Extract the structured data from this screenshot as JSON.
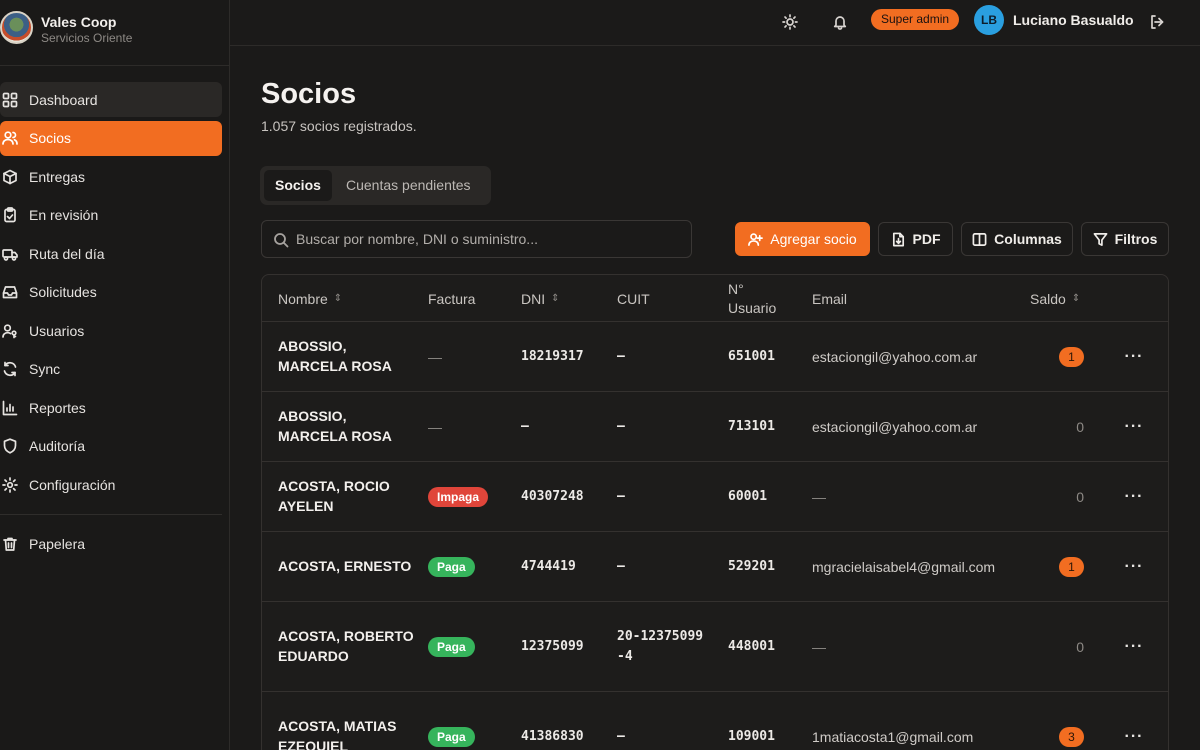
{
  "brand": {
    "name": "Vales Coop",
    "subtitle": "Servicios Oriente"
  },
  "sidebar": {
    "items": [
      {
        "label": "Dashboard",
        "icon": "dashboard-icon"
      },
      {
        "label": "Socios",
        "icon": "users-icon"
      },
      {
        "label": "Entregas",
        "icon": "package-icon"
      },
      {
        "label": "En revisión",
        "icon": "clipboard-icon"
      },
      {
        "label": "Ruta del día",
        "icon": "truck-icon"
      },
      {
        "label": "Solicitudes",
        "icon": "inbox-icon"
      },
      {
        "label": "Usuarios",
        "icon": "user-key-icon"
      },
      {
        "label": "Sync",
        "icon": "sync-icon"
      },
      {
        "label": "Reportes",
        "icon": "bar-chart-icon"
      },
      {
        "label": "Auditoría",
        "icon": "shield-icon"
      },
      {
        "label": "Configuración",
        "icon": "gear-icon"
      }
    ],
    "trash": {
      "label": "Papelera",
      "icon": "trash-icon"
    }
  },
  "topbar": {
    "role": "Super admin",
    "avatar_initials": "LB",
    "user_name": "Luciano Basualdo"
  },
  "page": {
    "title": "Socios",
    "subtitle": "1.057 socios registrados."
  },
  "tabs": [
    "Socios",
    "Cuentas pendientes"
  ],
  "search": {
    "placeholder": "Buscar por nombre, DNI o suministro...",
    "value": ""
  },
  "toolbar": {
    "add_label": "Agregar socio",
    "pdf_label": "PDF",
    "columns_label": "Columnas",
    "filters_label": "Filtros"
  },
  "table": {
    "headers": {
      "nombre": "Nombre",
      "factura": "Factura",
      "dni": "DNI",
      "cuit": "CUIT",
      "usuario": "N° Usuario",
      "email": "Email",
      "saldo": "Saldo"
    },
    "rows": [
      {
        "nombre": "ABOSSIO, MARCELA ROSA",
        "factura": "—",
        "dni": "18219317",
        "cuit": "–",
        "usuario": "651001",
        "email": "estaciongil@yahoo.com.ar",
        "saldo": "1"
      },
      {
        "nombre": "ABOSSIO, MARCELA ROSA",
        "factura": "—",
        "dni": "–",
        "cuit": "–",
        "usuario": "713101",
        "email": "estaciongil@yahoo.com.ar",
        "saldo": "0"
      },
      {
        "nombre": "ACOSTA, ROCIO AYELEN",
        "factura": "Impaga",
        "dni": "40307248",
        "cuit": "–",
        "usuario": "60001",
        "email": "—",
        "saldo": "0"
      },
      {
        "nombre": "ACOSTA, ERNESTO",
        "factura": "Paga",
        "dni": "4744419",
        "cuit": "–",
        "usuario": "529201",
        "email": "mgracielaisabel4@gmail.com",
        "saldo": "1"
      },
      {
        "nombre": "ACOSTA, ROBERTO EDUARDO",
        "factura": "Paga",
        "dni": "12375099",
        "cuit": "20-12375099-4",
        "usuario": "448001",
        "email": "—",
        "saldo": "0"
      },
      {
        "nombre": "ACOSTA, MATIAS EZEQUIEL",
        "factura": "Paga",
        "dni": "41386830",
        "cuit": "–",
        "usuario": "109001",
        "email": "1matiacosta1@gmail.com",
        "saldo": "3"
      }
    ],
    "more_glyph": "···"
  },
  "colors": {
    "accent": "#f26d21",
    "impaga": "#e0453a",
    "paga": "#36b45c",
    "avatar": "#2a9fe0"
  }
}
